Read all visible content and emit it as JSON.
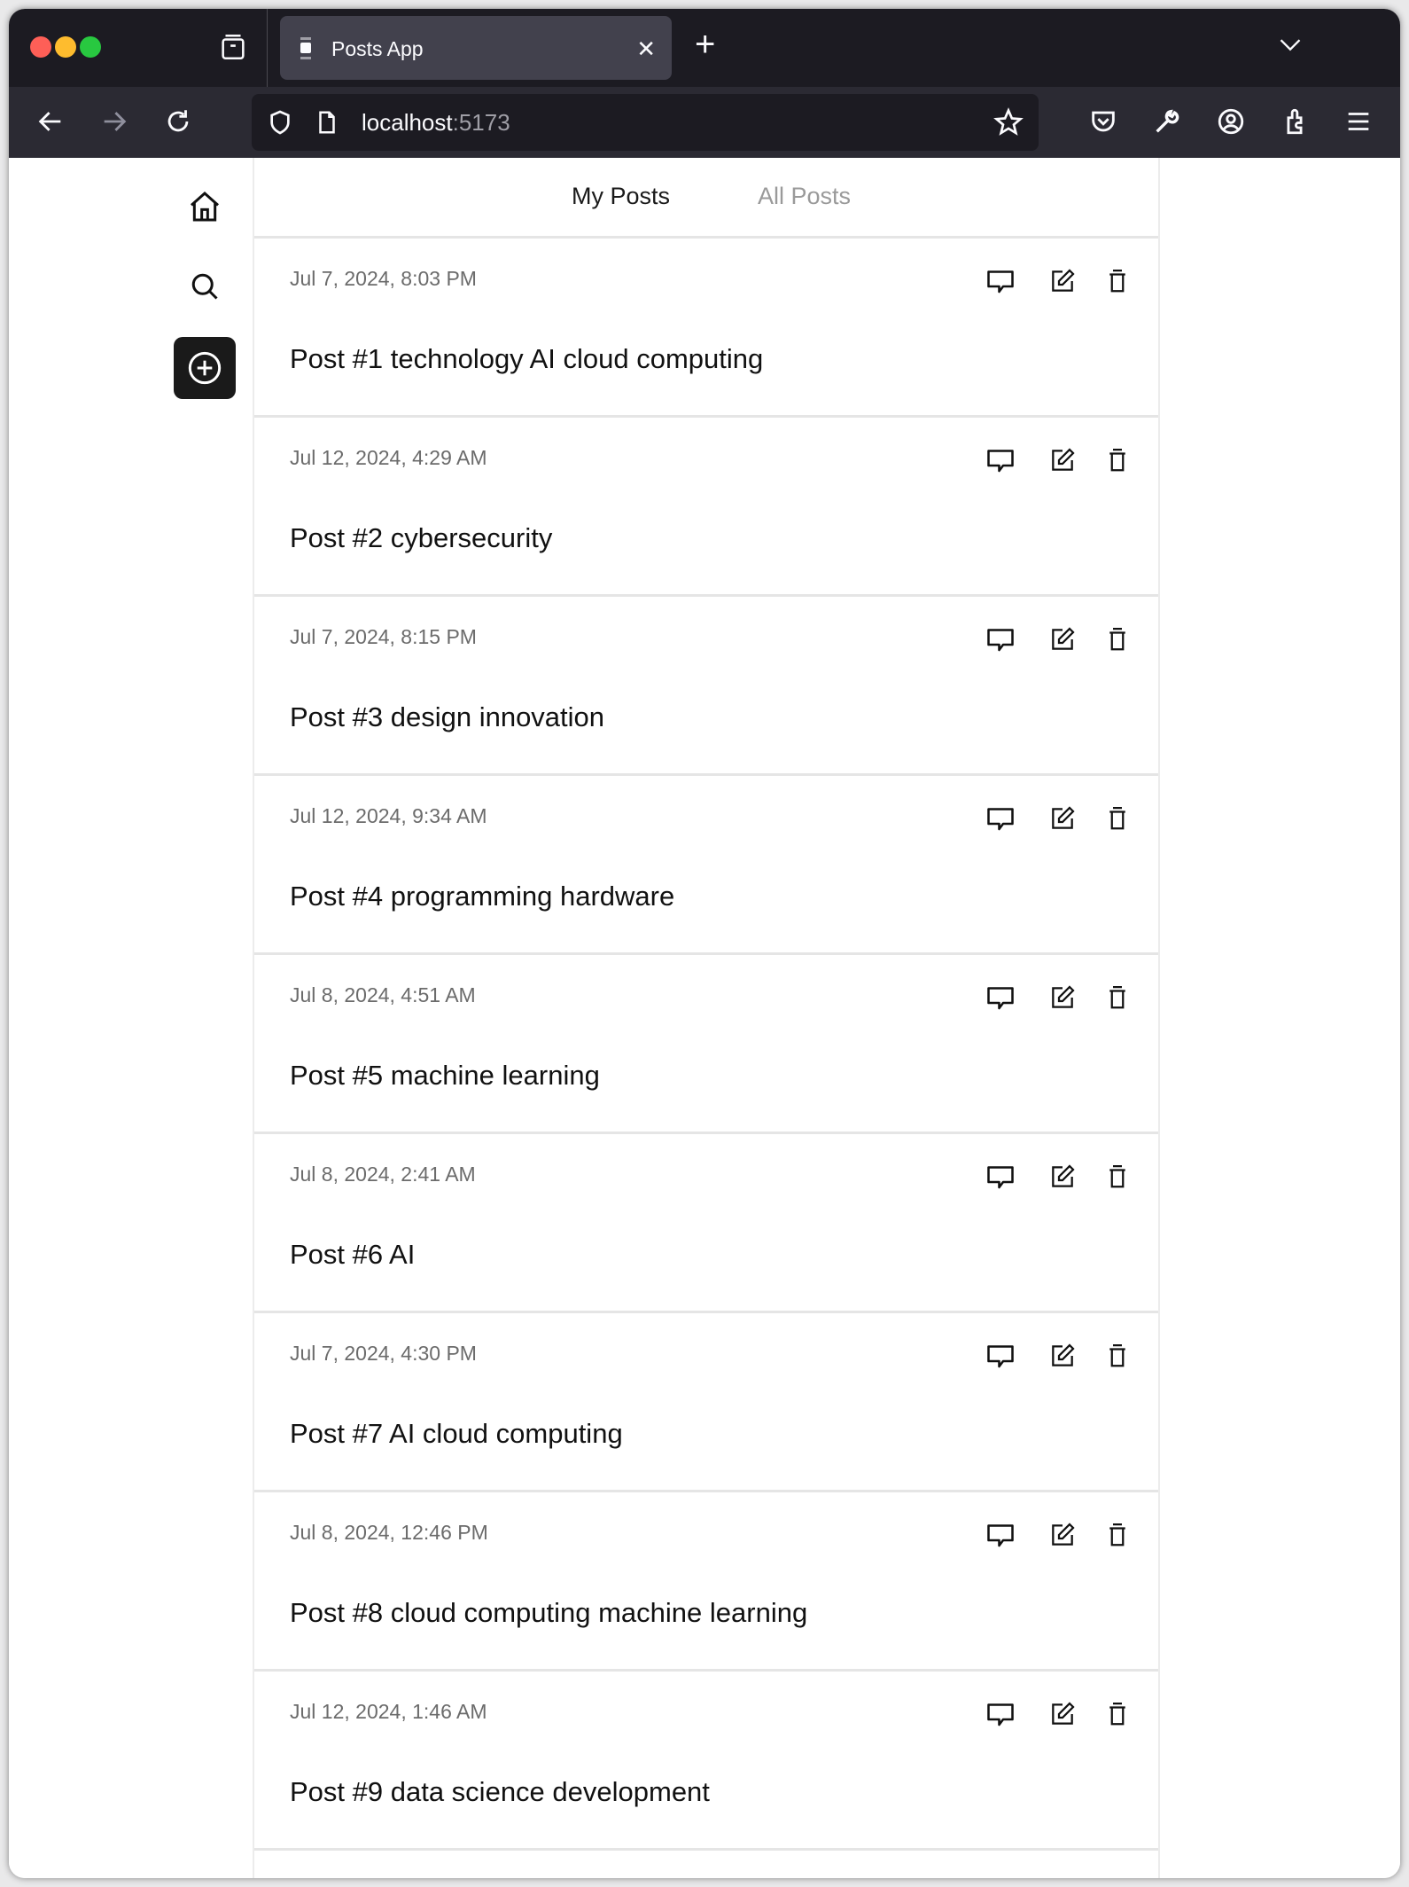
{
  "browser": {
    "tab_title": "Posts App",
    "url_host": "localhost",
    "url_port": ":5173",
    "traffic_lights": {
      "close": "#fe5f57",
      "minimize": "#febc2e",
      "maximize": "#28c840"
    }
  },
  "sidebar": {
    "items": [
      {
        "icon": "home-icon"
      },
      {
        "icon": "search-icon"
      },
      {
        "icon": "plus-circle-icon"
      }
    ]
  },
  "main": {
    "tabs": [
      {
        "label": "My Posts",
        "active": true
      },
      {
        "label": "All Posts",
        "active": false
      }
    ],
    "posts": [
      {
        "date": "Jul 7, 2024, 8:03 PM",
        "title": "Post #1 technology AI cloud computing"
      },
      {
        "date": "Jul 12, 2024, 4:29 AM",
        "title": "Post #2 cybersecurity"
      },
      {
        "date": "Jul 7, 2024, 8:15 PM",
        "title": "Post #3 design innovation"
      },
      {
        "date": "Jul 12, 2024, 9:34 AM",
        "title": "Post #4 programming hardware"
      },
      {
        "date": "Jul 8, 2024, 4:51 AM",
        "title": "Post #5 machine learning"
      },
      {
        "date": "Jul 8, 2024, 2:41 AM",
        "title": "Post #6 AI"
      },
      {
        "date": "Jul 7, 2024, 4:30 PM",
        "title": "Post #7 AI cloud computing"
      },
      {
        "date": "Jul 8, 2024, 12:46 PM",
        "title": "Post #8 cloud computing machine learning"
      },
      {
        "date": "Jul 12, 2024, 1:46 AM",
        "title": "Post #9 data science development"
      }
    ],
    "post_actions": [
      "comment-icon",
      "edit-icon",
      "delete-icon"
    ]
  }
}
